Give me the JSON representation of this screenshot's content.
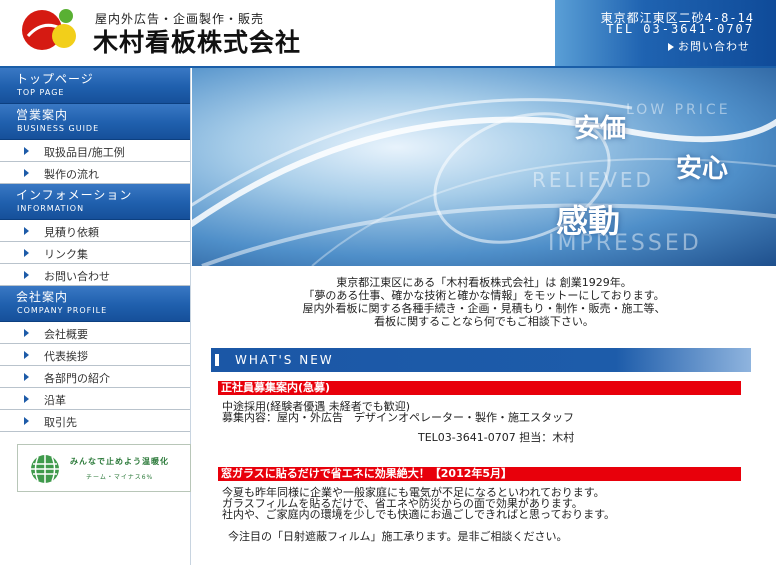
{
  "header": {
    "tagline": "屋内外広告・企画製作・販売",
    "company_name": "木村看板株式会社",
    "address": "東京都江東区二砂4-8-14",
    "tel": "TEL 03-3641-0707",
    "contact_link": "お問い合わせ"
  },
  "sidebar": {
    "sections": [
      {
        "jp": "トップページ",
        "en": "TOP PAGE",
        "items": []
      },
      {
        "jp": "営業案内",
        "en": "BUSINESS GUIDE",
        "items": [
          "取扱品目/施工例",
          "製作の流れ"
        ]
      },
      {
        "jp": "インフォメーション",
        "en": "INFORMATION",
        "items": [
          "見積り依頼",
          "リンク集",
          "お問い合わせ"
        ]
      },
      {
        "jp": "会社案内",
        "en": "COMPANY PROFILE",
        "items": [
          "会社概要",
          "代表挨拶",
          "各部門の紹介",
          "沿革",
          "取引先"
        ]
      }
    ],
    "banner": {
      "line1": "みんなで止めよう温暖化",
      "line2": "チーム・マイナス6%"
    }
  },
  "hero": {
    "words": [
      "安価",
      "安心",
      "感動"
    ],
    "english": [
      "LOW PRICE",
      "RELIEVED",
      "IMPRESSED"
    ]
  },
  "intro": {
    "lines": [
      "東京都江東区にある「木村看板株式会社」は 創業1929年。",
      "「夢のある仕事、確かな技術と確かな情報」をモットーにしております。",
      "屋内外看板に関する各種手続き・企画・見積もり・制作・販売・施工等、",
      "看板に関することなら何でもご相談下さい。"
    ]
  },
  "news": {
    "heading": "WHAT'S NEW",
    "items": [
      {
        "title": "正社員募集案内(急募)",
        "lines": [
          "中途採用(経験者優遇 未経者でも歓迎)",
          "募集内容：屋内・外広告　デザインオペレーター・製作・施工スタッフ",
          "TEL03-3641-0707 担当：木村"
        ]
      },
      {
        "title": "窓ガラスに貼るだけで省エネに効果絶大！【2012年5月】",
        "lines": [
          "今夏も昨年同様に企業や一般家庭にも電気が不足になるといわれております。",
          "ガラスフィルムを貼るだけで、省エネや防災からの面で効果があります。",
          "社内や、ご家庭内の環境を少しでも快適にお過ごしできればと思っております。",
          "",
          "今注目の「日射遮蔽フィルム」施工承ります。是非ご相談ください。"
        ]
      }
    ]
  },
  "colors": {
    "accent_blue": "#1d5ba8",
    "news_red": "#e8000b",
    "banner_green": "#2c7a3a"
  }
}
